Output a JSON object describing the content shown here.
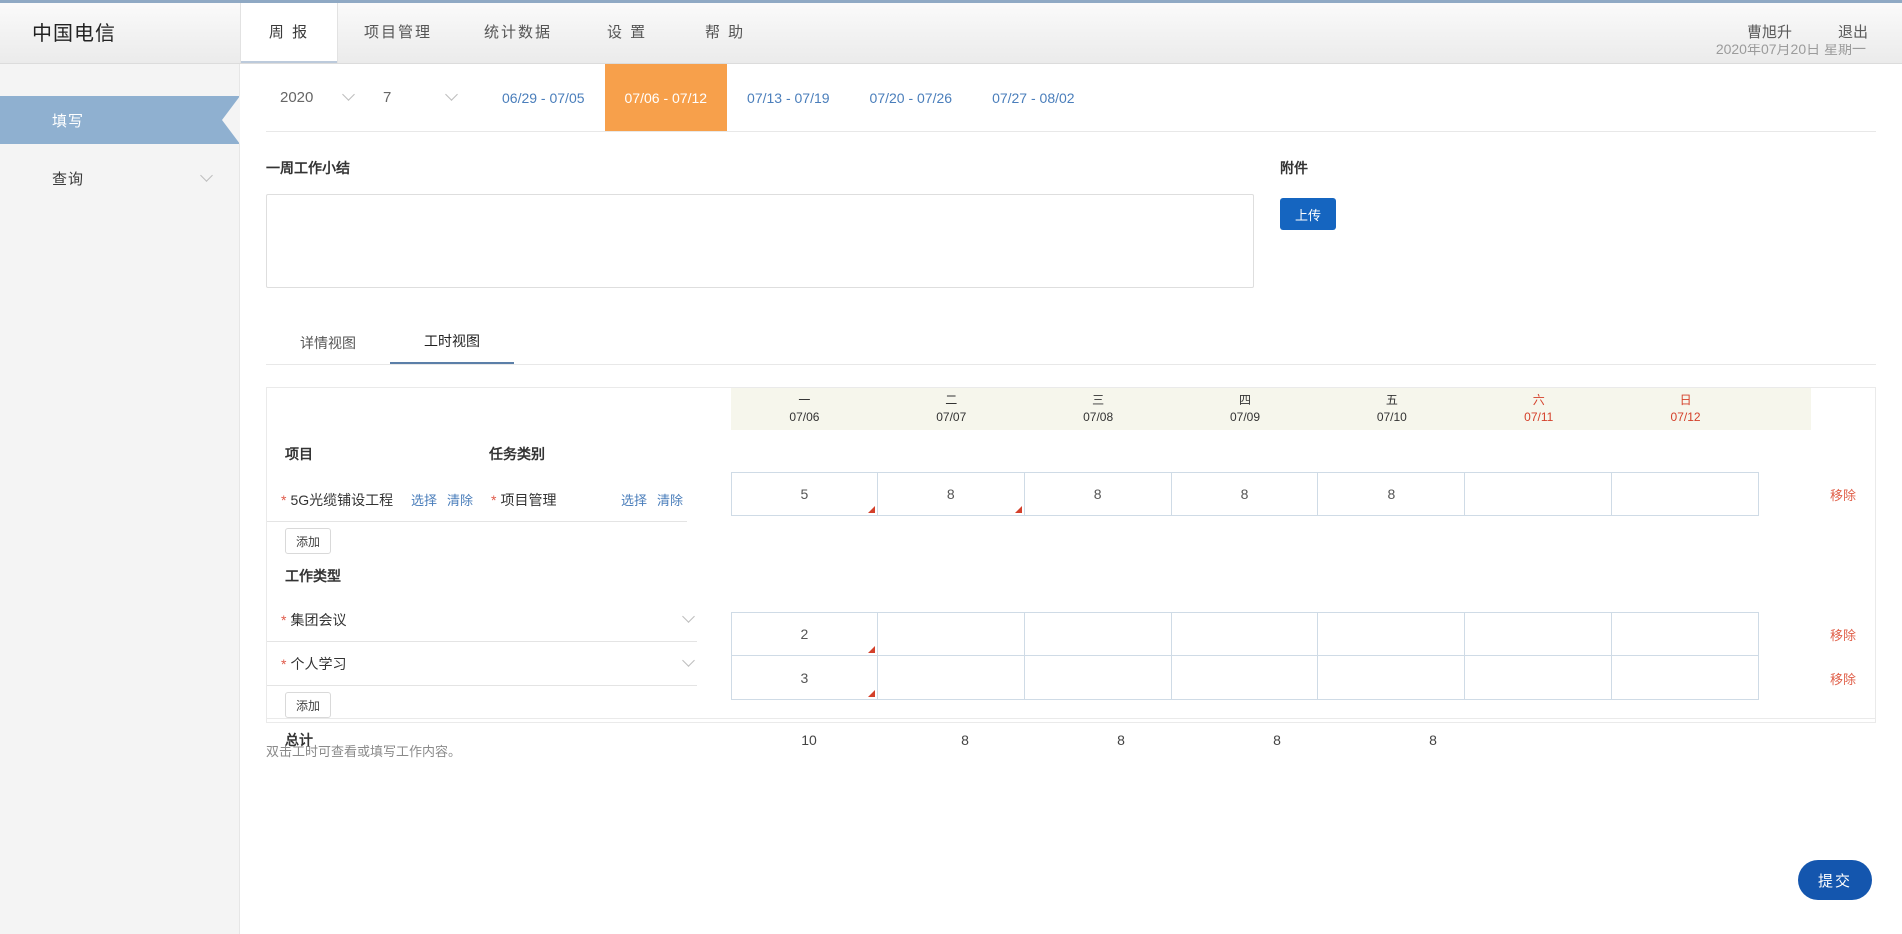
{
  "header": {
    "brand": "中国电信",
    "nav": [
      {
        "label": "周 报",
        "active": true
      },
      {
        "label": "项目管理",
        "active": false
      },
      {
        "label": "统计数据",
        "active": false
      },
      {
        "label": "设 置",
        "active": false
      },
      {
        "label": "帮 助",
        "active": false
      }
    ],
    "user": "曹旭升",
    "logout": "退出",
    "date_strip": "2020年07月20日 星期一"
  },
  "sidebar": {
    "items": [
      {
        "label": "填写",
        "active": true,
        "chevron": false
      },
      {
        "label": "查询",
        "active": false,
        "chevron": true
      }
    ]
  },
  "weekbar": {
    "year": "2020",
    "month": "7",
    "weeks": [
      {
        "label": "06/29 - 07/05",
        "active": false
      },
      {
        "label": "07/06 - 07/12",
        "active": true
      },
      {
        "label": "07/13 - 07/19",
        "active": false
      },
      {
        "label": "07/20 - 07/26",
        "active": false
      },
      {
        "label": "07/27 - 08/02",
        "active": false
      }
    ]
  },
  "summary": {
    "label": "一周工作小结",
    "value": "",
    "placeholder": ""
  },
  "attachment": {
    "label": "附件",
    "upload_label": "上传"
  },
  "view_tabs": [
    {
      "label": "详情视图",
      "active": false
    },
    {
      "label": "工时视图",
      "active": true
    }
  ],
  "timesheet": {
    "days": [
      {
        "weekday": "一",
        "date": "07/06",
        "weekend": false
      },
      {
        "weekday": "二",
        "date": "07/07",
        "weekend": false
      },
      {
        "weekday": "三",
        "date": "07/08",
        "weekend": false
      },
      {
        "weekday": "四",
        "date": "07/09",
        "weekend": false
      },
      {
        "weekday": "五",
        "date": "07/10",
        "weekend": false
      },
      {
        "weekday": "六",
        "date": "07/11",
        "weekend": true
      },
      {
        "weekday": "日",
        "date": "07/12",
        "weekend": true
      }
    ],
    "col_project": "项目",
    "col_task": "任务类别",
    "section_worktype": "工作类型",
    "action_select": "选择",
    "action_clear": "清除",
    "action_remove": "移除",
    "add_label": "添加",
    "project_rows": [
      {
        "project": "5G光缆铺设工程",
        "task": "项目管理",
        "hours": [
          "5",
          "8",
          "8",
          "8",
          "8",
          "",
          ""
        ],
        "flags": [
          true,
          true,
          false,
          false,
          false,
          false,
          false
        ]
      }
    ],
    "worktype_rows": [
      {
        "name": "集团会议",
        "hours": [
          "2",
          "",
          "",
          "",
          "",
          "",
          ""
        ],
        "flags": [
          true,
          false,
          false,
          false,
          false,
          false,
          false
        ]
      },
      {
        "name": "个人学习",
        "hours": [
          "3",
          "",
          "",
          "",
          "",
          "",
          ""
        ],
        "flags": [
          true,
          false,
          false,
          false,
          false,
          false,
          false
        ]
      }
    ],
    "total_label": "总计",
    "totals": [
      "10",
      "8",
      "8",
      "8",
      "8",
      "",
      ""
    ],
    "note": "双击工时可查看或填写工作内容。"
  },
  "submit": {
    "label": "提交"
  },
  "colors": {
    "accent_blue": "#1456ae",
    "tab_orange": "#f7a04b",
    "link_blue": "#4a7ebb",
    "weekend_red": "#d4402a",
    "sidebar_active": "#8fb0d0"
  }
}
